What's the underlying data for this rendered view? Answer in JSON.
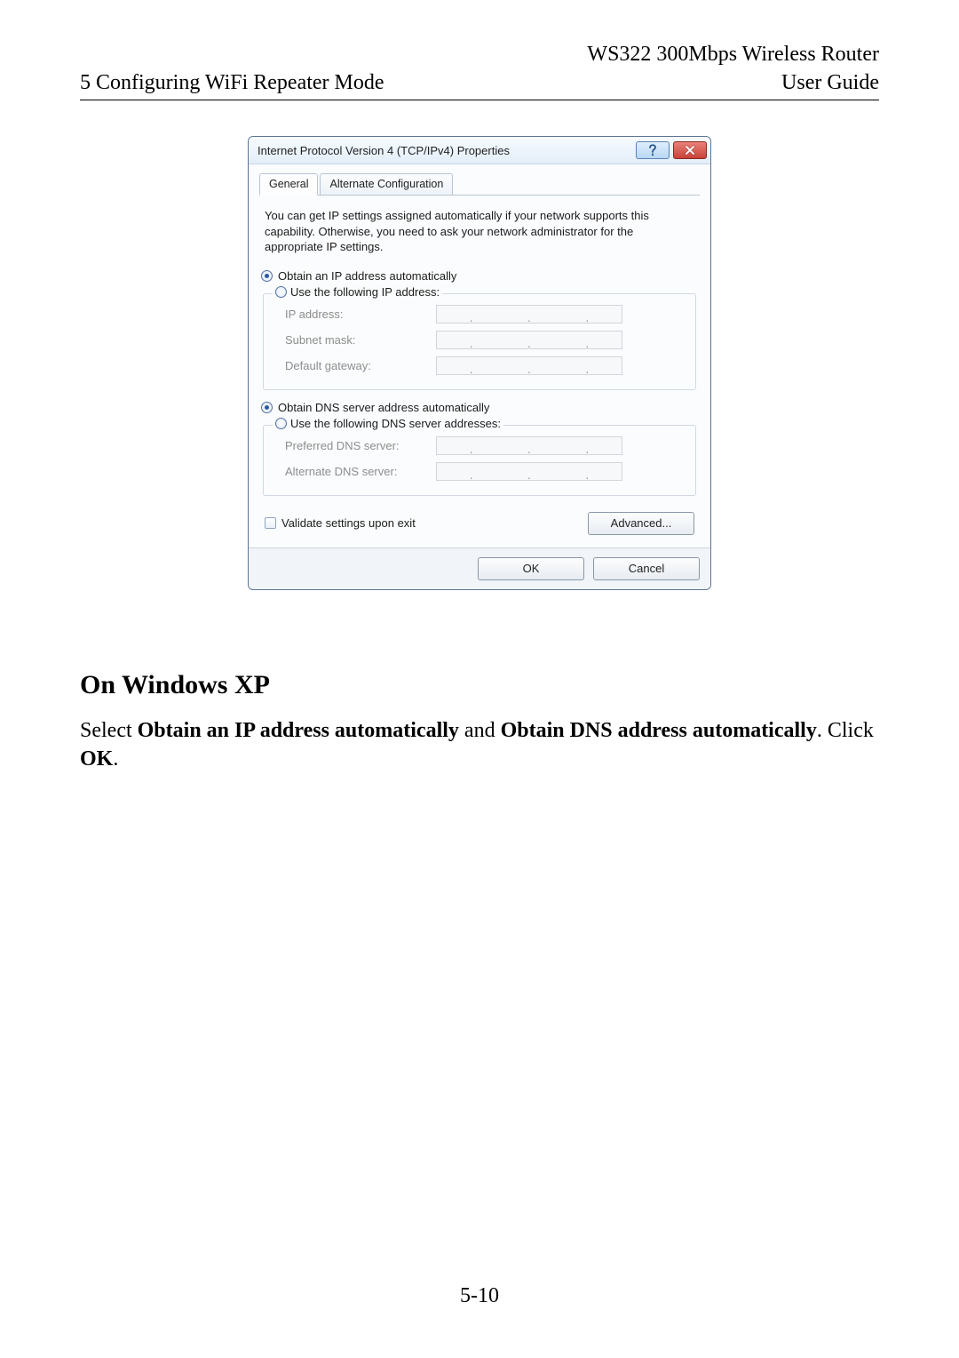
{
  "header": {
    "product_line": "WS322 300Mbps Wireless Router",
    "chapter": "5 Configuring WiFi Repeater Mode",
    "doc_type": "User Guide"
  },
  "page_number": "5-10",
  "dialog": {
    "title": "Internet Protocol Version 4 (TCP/IPv4) Properties",
    "tabs": {
      "general": "General",
      "alt": "Alternate Configuration"
    },
    "intro": "You can get IP settings assigned automatically if your network supports this capability. Otherwise, you need to ask your network administrator for the appropriate IP settings.",
    "ip": {
      "auto": "Obtain an IP address automatically",
      "manual": "Use the following IP address:",
      "addr_label": "IP address:",
      "mask_label": "Subnet mask:",
      "gw_label": "Default gateway:"
    },
    "dns": {
      "auto": "Obtain DNS server address automatically",
      "manual": "Use the following DNS server addresses:",
      "pref_label": "Preferred DNS server:",
      "alt_label": "Alternate DNS server:"
    },
    "validate_label": "Validate settings upon exit",
    "advanced_btn": "Advanced...",
    "ok_btn": "OK",
    "cancel_btn": "Cancel"
  },
  "body": {
    "heading": "On Windows XP",
    "p_pre": "Select ",
    "p_b1": "Obtain an IP address automatically",
    "p_mid": " and ",
    "p_b2": "Obtain DNS address automatically",
    "p_post1": ". Click ",
    "p_b3": "OK",
    "p_post2": "."
  }
}
